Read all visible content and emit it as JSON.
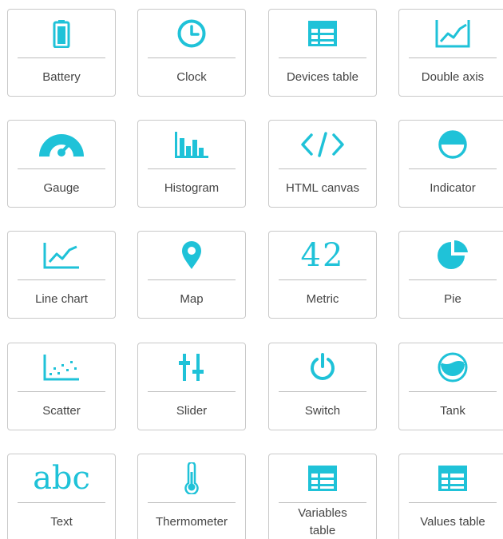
{
  "accent_color": "#1fc2d8",
  "widgets": [
    {
      "label": "Battery",
      "icon": "battery-icon"
    },
    {
      "label": "Clock",
      "icon": "clock-icon"
    },
    {
      "label": "Devices table",
      "icon": "table-icon"
    },
    {
      "label": "Double axis",
      "icon": "double-axis-chart-icon"
    },
    {
      "label": "Gauge",
      "icon": "gauge-icon"
    },
    {
      "label": "Histogram",
      "icon": "histogram-icon"
    },
    {
      "label": "HTML canvas",
      "icon": "code-icon"
    },
    {
      "label": "Indicator",
      "icon": "indicator-icon"
    },
    {
      "label": "Line chart",
      "icon": "line-chart-icon"
    },
    {
      "label": "Map",
      "icon": "map-pin-icon"
    },
    {
      "label": "Metric",
      "icon": "metric-number-icon",
      "icon_text": "42"
    },
    {
      "label": "Pie",
      "icon": "pie-chart-icon"
    },
    {
      "label": "Scatter",
      "icon": "scatter-chart-icon"
    },
    {
      "label": "Slider",
      "icon": "slider-icon"
    },
    {
      "label": "Switch",
      "icon": "power-switch-icon"
    },
    {
      "label": "Tank",
      "icon": "tank-icon"
    },
    {
      "label": "Text",
      "icon": "text-abc-icon",
      "icon_text": "abc"
    },
    {
      "label": "Thermometer",
      "icon": "thermometer-icon"
    },
    {
      "label": "Variables table",
      "icon": "table-icon"
    },
    {
      "label": "Values table",
      "icon": "table-icon"
    }
  ]
}
